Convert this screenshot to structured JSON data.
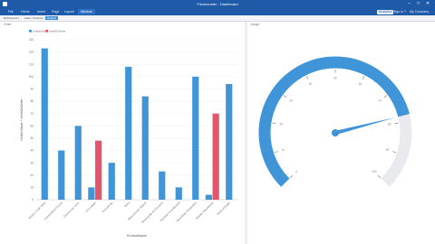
{
  "window": {
    "title": "Flexmonster - Dashboard",
    "minimize_glyph": "–",
    "maximize_glyph": "□",
    "close_glyph": "✕"
  },
  "ribbon": {
    "tabs": [
      {
        "label": "File",
        "active": false
      },
      {
        "label": "Home",
        "active": false
      },
      {
        "label": "Insert",
        "active": false
      },
      {
        "label": "Page",
        "active": false
      },
      {
        "label": "Layout",
        "active": false
      },
      {
        "label": "Window",
        "active": true
      }
    ],
    "right": {
      "search_pill": "Analytics",
      "signin": "Sign in",
      "help": "?",
      "company": "My Company"
    }
  },
  "toolbar": {
    "items": [
      {
        "label": "Dashboard 1",
        "active": false
      },
      {
        "label": "Sales",
        "active": false
      },
      {
        "label": "Products",
        "active": false
      },
      {
        "label": "Default",
        "active": true
      }
    ]
  },
  "colors": {
    "accent": "#3e8fd8",
    "bar_blue": "#3f95d8",
    "bar_red": "#e2566c",
    "gauge_track": "#e9eaee"
  },
  "chart_panel": {
    "title": "Chart"
  },
  "gauge_panel": {
    "title": "Gauge"
  },
  "chart_data": {
    "type": "bar",
    "title": "",
    "xlabel": "ProductName",
    "ylabel": "UnitsInStock + UnitsOnOrder",
    "ylim": [
      0,
      130
    ],
    "grid": true,
    "legend": "top-left",
    "categories": [
      "Boston Crab Meat",
      "Camembert Pierrot",
      "Chartreuse verte",
      "Chocolade",
      "Gravad lax",
      "Ikura",
      "Mascarpone Fabioli",
      "Mozzarella di Giovanni",
      "Raclette Courdavault",
      "Rhönbräu Klosterbier",
      "Rössle Sauerkraut",
      "Sirop d'érable"
    ],
    "series": [
      {
        "name": "UnitsInStock",
        "values": [
          123,
          40,
          60,
          10,
          30,
          108,
          84,
          23,
          10,
          100,
          4,
          94
        ]
      },
      {
        "name": "UnitsOnOrder",
        "values": [
          0,
          0,
          0,
          48,
          0,
          0,
          0,
          0,
          0,
          0,
          70,
          0
        ]
      }
    ],
    "yticks": [
      0,
      10,
      20,
      30,
      40,
      50,
      60,
      70,
      80,
      90,
      100,
      110,
      120,
      130
    ]
  },
  "gauge_data": {
    "type": "gauge",
    "min": 0,
    "max": 100,
    "value": 78,
    "ticks": [
      "0",
      "10",
      "20",
      "30",
      "40",
      "50",
      "60",
      "70",
      "80",
      "90",
      "100"
    ]
  }
}
